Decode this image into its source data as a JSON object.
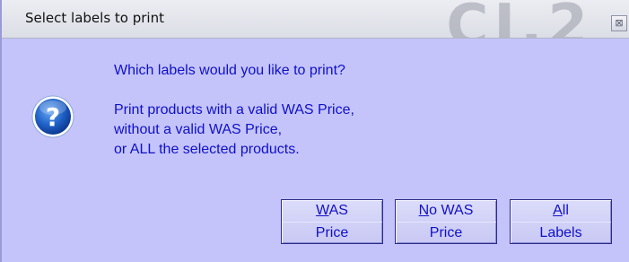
{
  "window": {
    "title": "Select labels to print",
    "close_glyph": "⊠",
    "watermark": "CI.2"
  },
  "message": {
    "question": "Which labels would you like to print?",
    "lines": [
      "Print products with a valid WAS Price,",
      "without a valid WAS Price,",
      "or ALL the selected products."
    ]
  },
  "buttons": {
    "was": {
      "accel": "W",
      "line1_rest": "AS",
      "line2": "Price"
    },
    "no_was": {
      "accel": "N",
      "line1_rest": "o WAS",
      "line2": "Price"
    },
    "all": {
      "accel": "A",
      "line1_rest": "ll",
      "line2": "Labels"
    }
  },
  "colors": {
    "dialog_bg": "#c4c4fb",
    "text": "#1010c8",
    "icon": "#1560c8"
  },
  "icons": {
    "dialog": "question-icon",
    "close": "close-icon"
  }
}
